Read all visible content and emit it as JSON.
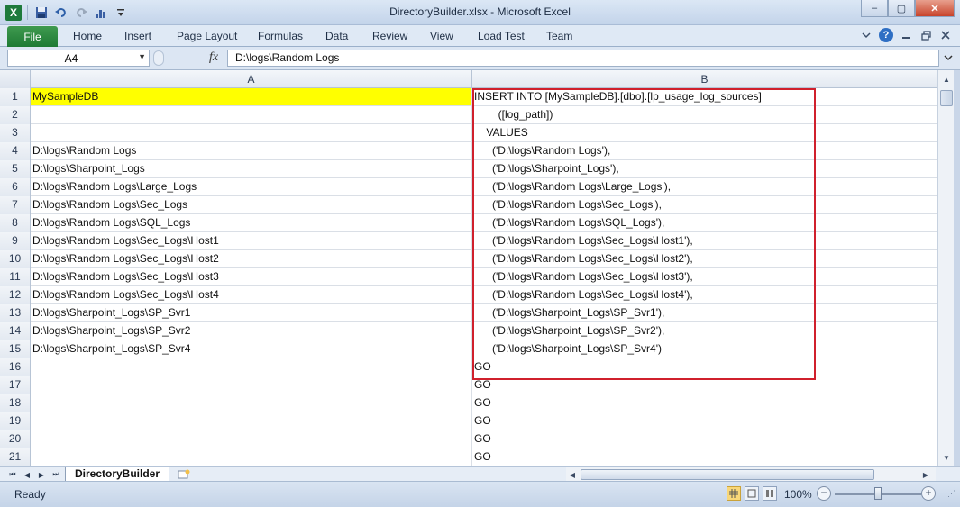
{
  "window": {
    "title": "DirectoryBuilder.xlsx - Microsoft Excel",
    "minimize": "–",
    "maximize": "▢",
    "close": "✕"
  },
  "ribbon": {
    "file_label": "File",
    "tabs": [
      "Home",
      "Insert",
      "Page Layout",
      "Formulas",
      "Data",
      "Review",
      "View",
      "Load Test",
      "Team"
    ]
  },
  "formula_bar": {
    "name_box": "A4",
    "fx": "fx",
    "value": "D:\\logs\\Random Logs"
  },
  "columns": [
    "A",
    "B"
  ],
  "rows": [
    {
      "num": "1",
      "a": "MySampleDB",
      "b": "INSERT INTO [MySampleDB].[dbo].[lp_usage_log_sources]"
    },
    {
      "num": "2",
      "a": "",
      "b": "        ([log_path])"
    },
    {
      "num": "3",
      "a": "",
      "b": "    VALUES"
    },
    {
      "num": "4",
      "a": "D:\\logs\\Random Logs",
      "b": "      ('D:\\logs\\Random Logs'),"
    },
    {
      "num": "5",
      "a": "D:\\logs\\Sharpoint_Logs",
      "b": "      ('D:\\logs\\Sharpoint_Logs'),"
    },
    {
      "num": "6",
      "a": "D:\\logs\\Random Logs\\Large_Logs",
      "b": "      ('D:\\logs\\Random Logs\\Large_Logs'),"
    },
    {
      "num": "7",
      "a": "D:\\logs\\Random Logs\\Sec_Logs",
      "b": "      ('D:\\logs\\Random Logs\\Sec_Logs'),"
    },
    {
      "num": "8",
      "a": "D:\\logs\\Random Logs\\SQL_Logs",
      "b": "      ('D:\\logs\\Random Logs\\SQL_Logs'),"
    },
    {
      "num": "9",
      "a": "D:\\logs\\Random Logs\\Sec_Logs\\Host1",
      "b": "      ('D:\\logs\\Random Logs\\Sec_Logs\\Host1'),"
    },
    {
      "num": "10",
      "a": "D:\\logs\\Random Logs\\Sec_Logs\\Host2",
      "b": "      ('D:\\logs\\Random Logs\\Sec_Logs\\Host2'),"
    },
    {
      "num": "11",
      "a": "D:\\logs\\Random Logs\\Sec_Logs\\Host3",
      "b": "      ('D:\\logs\\Random Logs\\Sec_Logs\\Host3'),"
    },
    {
      "num": "12",
      "a": "D:\\logs\\Random Logs\\Sec_Logs\\Host4",
      "b": "      ('D:\\logs\\Random Logs\\Sec_Logs\\Host4'),"
    },
    {
      "num": "13",
      "a": "D:\\logs\\Sharpoint_Logs\\SP_Svr1",
      "b": "      ('D:\\logs\\Sharpoint_Logs\\SP_Svr1'),"
    },
    {
      "num": "14",
      "a": "D:\\logs\\Sharpoint_Logs\\SP_Svr2",
      "b": "      ('D:\\logs\\Sharpoint_Logs\\SP_Svr2'),"
    },
    {
      "num": "15",
      "a": "D:\\logs\\Sharpoint_Logs\\SP_Svr4",
      "b": "      ('D:\\logs\\Sharpoint_Logs\\SP_Svr4')"
    },
    {
      "num": "16",
      "a": "",
      "b": "GO"
    },
    {
      "num": "17",
      "a": "",
      "b": "GO"
    },
    {
      "num": "18",
      "a": "",
      "b": "GO"
    },
    {
      "num": "19",
      "a": "",
      "b": "GO"
    },
    {
      "num": "20",
      "a": "",
      "b": "GO"
    },
    {
      "num": "21",
      "a": "",
      "b": "GO"
    }
  ],
  "highlight_color": "#ffff00",
  "annotation_color": "#d0202c",
  "sheets": [
    "DirectoryBuilder"
  ],
  "status": {
    "ready": "Ready",
    "zoom": "100%",
    "zoom_level": 1.0
  }
}
